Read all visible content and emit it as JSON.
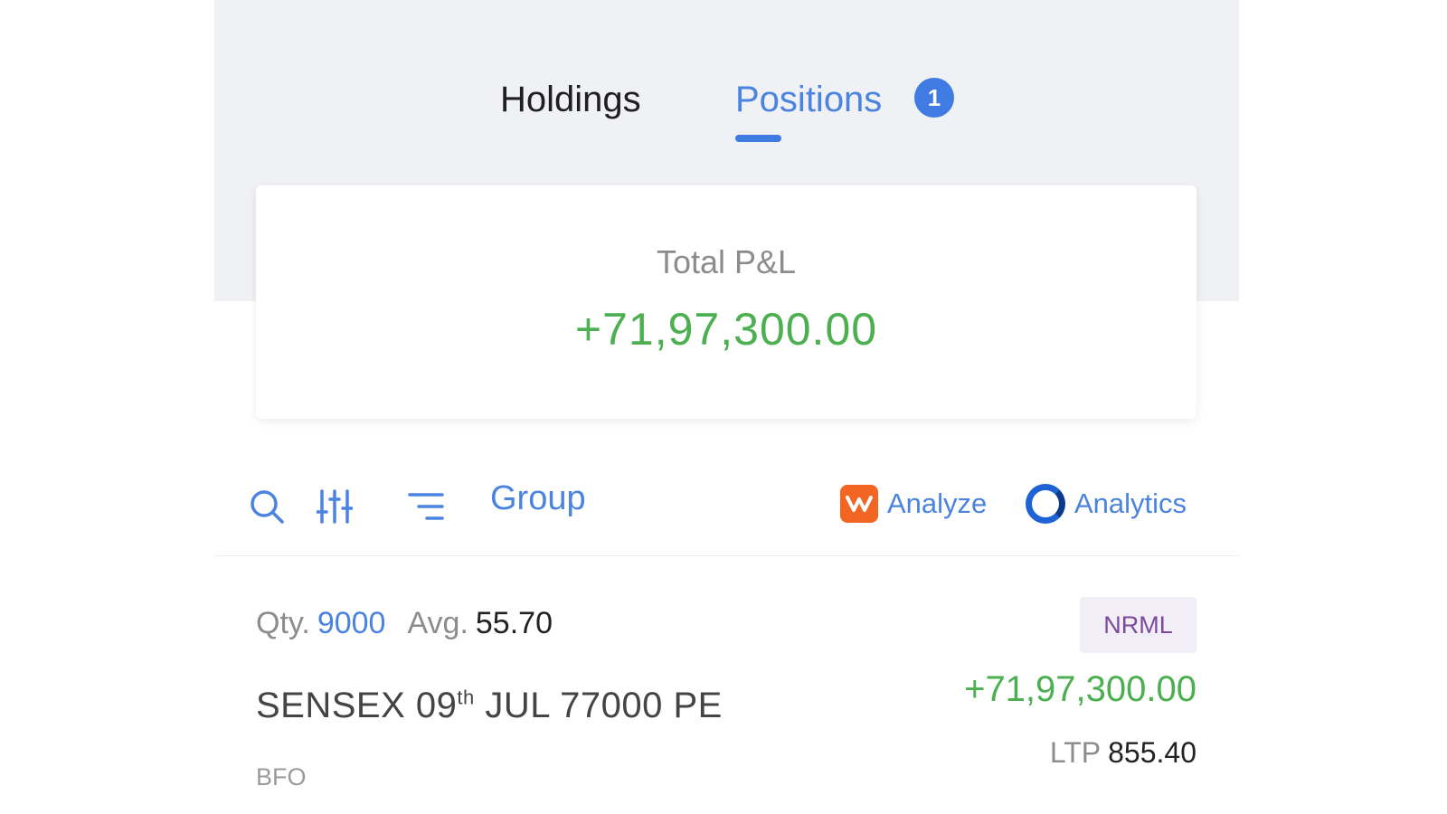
{
  "tabs": [
    {
      "label": "Holdings",
      "active": false
    },
    {
      "label": "Positions",
      "active": true,
      "badge": "1"
    }
  ],
  "summary": {
    "total_pnl_label": "Total P&L",
    "total_pnl_value": "+71,97,300.00"
  },
  "toolbar": {
    "search_icon": "search-icon",
    "filter_icon": "sliders-icon",
    "sort_icon": "sort-lines-icon",
    "group_label": "Group",
    "analyze_label": "Analyze",
    "analytics_label": "Analytics"
  },
  "positions": [
    {
      "qty_label": "Qty.",
      "qty_value": "9000",
      "avg_label": "Avg.",
      "avg_value": "55.70",
      "product": "NRML",
      "instrument_prefix": "SENSEX 09",
      "instrument_suffix_sup": "th",
      "instrument_rest": " JUL 77000 PE",
      "pnl": "+71,97,300.00",
      "ltp_label": "LTP",
      "ltp_value": "855.40",
      "exchange": "BFO"
    }
  ],
  "colors": {
    "accent": "#4a84e0",
    "profit": "#4caf50",
    "header_bg": "#f0f1f4",
    "analyze_brand": "#f26522"
  }
}
